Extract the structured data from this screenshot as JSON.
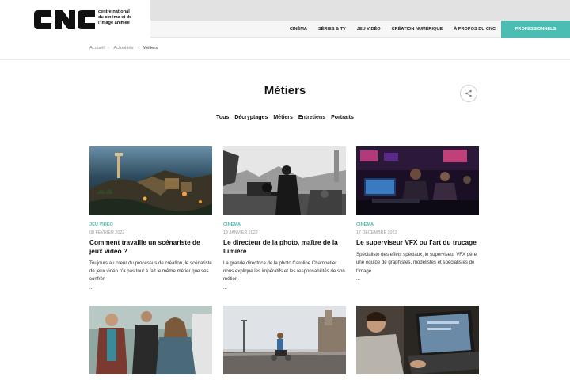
{
  "logo": {
    "name": "CNC",
    "lines": [
      "centre national",
      "du cinéma et de",
      "l'image animée"
    ]
  },
  "nav": {
    "items": [
      "CINÉMA",
      "SÉRIES & TV",
      "JEU VIDÉO",
      "CRÉATION NUMÉRIQUE",
      "À PROPOS DU CNC"
    ],
    "pro_label": "PROFESSIONNELS"
  },
  "breadcrumb": {
    "items": [
      "Accueil",
      "Actualités"
    ],
    "current": "Métiers"
  },
  "page": {
    "title": "Métiers"
  },
  "filters": [
    "Tous",
    "Décryptages",
    "Métiers",
    "Entretiens",
    "Portraits"
  ],
  "articles": [
    {
      "category": "JEU VIDÉO",
      "date": "08 FÉVRIER 2022",
      "title": "Comment travaille un scénariste de jeux vidéo ?",
      "description": "Toujours au cœur du processus de création, le scénariste de jeux vidéo n'a pas tout à fait le même métier que ses confrèr",
      "more": "..."
    },
    {
      "category": "CINÉMA",
      "date": "19 JANVIER 2022",
      "title": "Le directeur de la photo, maître de la lumière",
      "description": "La grande directrice de la photo Caroline Champetier nous explique les impératifs et les responsabilités de son métier.",
      "more": "..."
    },
    {
      "category": "CINÉMA",
      "date": "17 DÉCEMBRE 2021",
      "title": "Le superviseur VFX ou l'art du trucage",
      "description": "Spécialiste des effets spéciaux, le superviseur VFX gère une équipe de graphistes, modélistes et spécialistes de l'image",
      "more": "..."
    }
  ],
  "colors": {
    "accent": "#4cbdb3",
    "topband": "#e2e2e2",
    "navbar": "#f6f6f6"
  }
}
